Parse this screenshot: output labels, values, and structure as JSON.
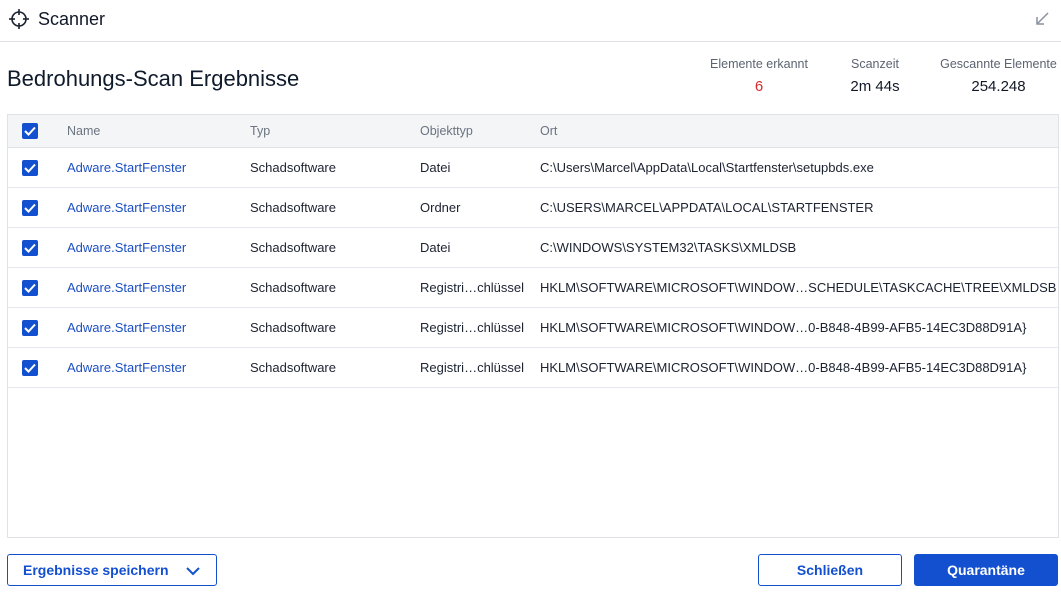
{
  "titlebar": {
    "title": "Scanner",
    "app_icon": "crosshair-icon",
    "minimize_icon": "arrow-down-left-icon"
  },
  "page": {
    "title": "Bedrohungs-Scan Ergebnisse"
  },
  "stats": [
    {
      "label": "Elemente erkannt",
      "value": "6",
      "color": "#d62b2b"
    },
    {
      "label": "Scanzeit",
      "value": "2m 44s"
    },
    {
      "label": "Gescannte Elemente",
      "value": "254.248"
    }
  ],
  "table": {
    "headers": {
      "name": "Name",
      "type": "Typ",
      "object_type": "Objekttyp",
      "location": "Ort"
    },
    "all_checked": true,
    "rows": [
      {
        "checked": true,
        "name": "Adware.StartFenster",
        "type": "Schadsoftware",
        "object_type": "Datei",
        "location": "C:\\Users\\Marcel\\AppData\\Local\\Startfenster\\setupbds.exe"
      },
      {
        "checked": true,
        "name": "Adware.StartFenster",
        "type": "Schadsoftware",
        "object_type": "Ordner",
        "location": "C:\\USERS\\MARCEL\\APPDATA\\LOCAL\\STARTFENSTER"
      },
      {
        "checked": true,
        "name": "Adware.StartFenster",
        "type": "Schadsoftware",
        "object_type": "Datei",
        "location": "C:\\WINDOWS\\SYSTEM32\\TASKS\\XMLDSB"
      },
      {
        "checked": true,
        "name": "Adware.StartFenster",
        "type": "Schadsoftware",
        "object_type": "Registri…chlüssel",
        "location": "HKLM\\SOFTWARE\\MICROSOFT\\WINDOW…SCHEDULE\\TASKCACHE\\TREE\\XMLDSB"
      },
      {
        "checked": true,
        "name": "Adware.StartFenster",
        "type": "Schadsoftware",
        "object_type": "Registri…chlüssel",
        "location": "HKLM\\SOFTWARE\\MICROSOFT\\WINDOW…0-B848-4B99-AFB5-14EC3D88D91A}"
      },
      {
        "checked": true,
        "name": "Adware.StartFenster",
        "type": "Schadsoftware",
        "object_type": "Registri…chlüssel",
        "location": "HKLM\\SOFTWARE\\MICROSOFT\\WINDOW…0-B848-4B99-AFB5-14EC3D88D91A}"
      }
    ]
  },
  "footer": {
    "save_label": "Ergebnisse speichern",
    "close_label": "Schließen",
    "quarantine_label": "Quarantäne"
  },
  "colors": {
    "accent": "#1350d0",
    "detected": "#d62b2b",
    "link": "#1b4fc4"
  }
}
